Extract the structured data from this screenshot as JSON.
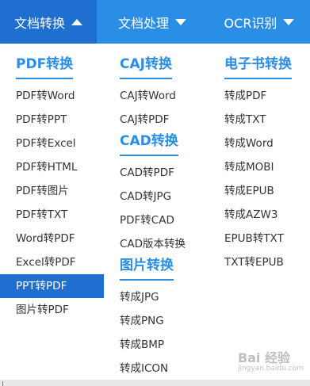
{
  "nav": {
    "tabs": [
      {
        "label": "文档转换"
      },
      {
        "label": "文档处理"
      },
      {
        "label": "OCR识别"
      }
    ]
  },
  "menu": {
    "columns": [
      {
        "groups": [
          {
            "heading": "PDF转换",
            "items": [
              "PDF转Word",
              "PDF转PPT",
              "PDF转Excel",
              "PDF转HTML",
              "PDF转图片",
              "PDF转TXT",
              "Word转PDF",
              "Excel转PDF",
              "PPT转PDF",
              "图片转PDF"
            ]
          }
        ]
      },
      {
        "groups": [
          {
            "heading": "CAJ转换",
            "items": [
              "CAJ转Word",
              "CAJ转PDF"
            ]
          },
          {
            "heading": "CAD转换",
            "items": [
              "CAD转PDF",
              "CAD转JPG",
              "PDF转CAD",
              "CAD版本转换"
            ]
          },
          {
            "heading": "图片转换",
            "items": [
              "转成JPG",
              "转成PNG",
              "转成BMP",
              "转成ICON"
            ]
          }
        ]
      },
      {
        "groups": [
          {
            "heading": "电子书转换",
            "items": [
              "转成PDF",
              "转成TXT",
              "转成Word",
              "转成MOBI",
              "转成EPUB",
              "转成AZW3",
              "EPUB转TXT",
              "TXT转EPUB"
            ]
          }
        ]
      }
    ]
  },
  "watermark": {
    "text": "Bai 经验",
    "sub": "jingyan.baidu.com"
  },
  "colors": {
    "accent": "#2a8ee6",
    "active": "#1e6fcf"
  }
}
